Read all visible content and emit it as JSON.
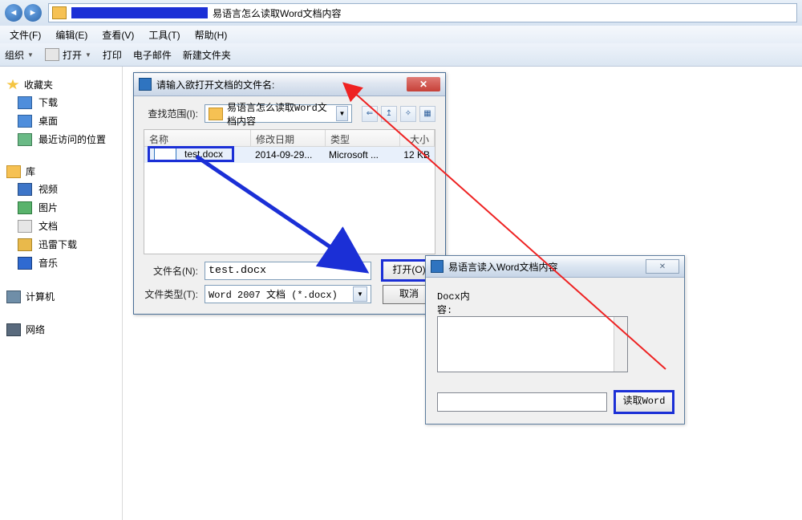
{
  "addressbar": {
    "path_text": "易语言怎么读取Word文档内容"
  },
  "menubar": {
    "file": "文件(F)",
    "edit": "编辑(E)",
    "view": "查看(V)",
    "tools": "工具(T)",
    "help": "帮助(H)"
  },
  "cmdbar": {
    "organize": "组织",
    "open": "打开",
    "print": "打印",
    "email": "电子邮件",
    "newfolder": "新建文件夹"
  },
  "sidebar": {
    "fav_title": "收藏夹",
    "fav_items": [
      "下载",
      "桌面",
      "最近访问的位置"
    ],
    "lib_title": "库",
    "lib_items": [
      "视频",
      "图片",
      "文档",
      "迅雷下载",
      "音乐"
    ],
    "computer": "计算机",
    "network": "网络"
  },
  "open_dialog": {
    "title": "请输入欲打开文档的文件名:",
    "range_label": "查找范围(I):",
    "range_value": "易语言怎么读取Word文档内容",
    "columns": {
      "name": "名称",
      "date": "修改日期",
      "type": "类型",
      "size": "大小"
    },
    "row": {
      "name": "test.docx",
      "date": "2014-09-29...",
      "type": "Microsoft ...",
      "size": "12 KB"
    },
    "filename_label": "文件名(N):",
    "filename_value": "test.docx",
    "filetype_label": "文件类型(T):",
    "filetype_value": "Word 2007 文档 (*.docx)",
    "open_btn": "打开(O)",
    "cancel_btn": "取消"
  },
  "app_window": {
    "title": "易语言读入Word文档内容",
    "content_label": "Docx内容:",
    "read_btn": "读取Word"
  }
}
